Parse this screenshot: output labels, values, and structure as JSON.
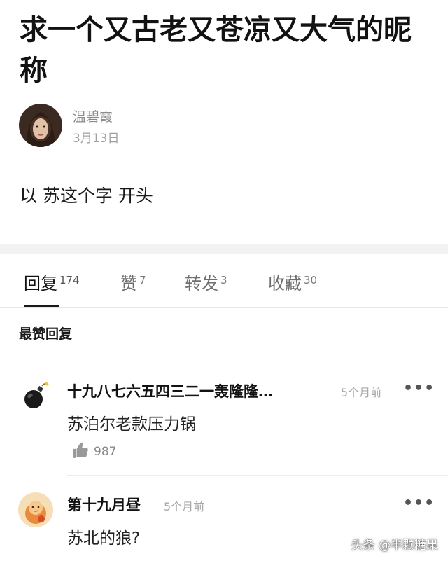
{
  "post": {
    "title": "求一个又古老又苍凉又大气的昵称",
    "author": {
      "name": "温碧霞",
      "date": "3月13日"
    },
    "body": "以 苏这个字 开头"
  },
  "tabs": [
    {
      "label": "回复",
      "count": "174",
      "active": true
    },
    {
      "label": "赞",
      "count": "7",
      "active": false
    },
    {
      "label": "转发",
      "count": "3",
      "active": false
    },
    {
      "label": "收藏",
      "count": "30",
      "active": false
    }
  ],
  "section_heading": "最赞回复",
  "comments": [
    {
      "name": "十九八七六五四三二一轰隆隆…",
      "time": "5个月前",
      "more": "•••",
      "text": "苏泊尔老款压力锅",
      "likes": "987"
    },
    {
      "name": "第十九月昼",
      "time": "5个月前",
      "more": "•••",
      "text": "苏北的狼?"
    }
  ],
  "watermark": "头条 @半颗糖果",
  "icons": {
    "author_avatar": "author-avatar-photo",
    "comment1_avatar": "bomb-icon",
    "comment2_avatar": "cartoon-avatar",
    "like": "thumbs-up-icon",
    "more": "more-dots-icon"
  }
}
